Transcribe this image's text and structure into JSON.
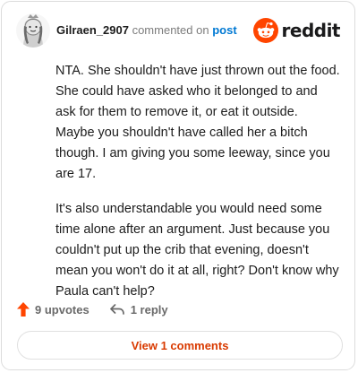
{
  "header": {
    "username": "Gilraen_2907",
    "action_text": "commented on",
    "target_link": "post",
    "brand_name": "reddit",
    "brand_color": "#ff4500"
  },
  "comment": {
    "paragraphs": [
      "NTA. She shouldn't have just thrown out the food. She could have asked who it belonged to and ask for them to remove it, or eat it outside. Maybe you shouldn't have called her a bitch though. I am giving you some leeway, since you are 17.",
      "It's also understandable you would need some time alone after an argument. Just because you couldn't put up the crib that evening, doesn't mean you won't do it at all, right? Don't know why Paula can't help?"
    ]
  },
  "actions": {
    "upvotes_label": "9 upvotes",
    "upvote_icon": "upvote-arrow-icon",
    "upvote_color": "#ff4500",
    "reply_label": "1 reply",
    "reply_icon": "reply-arrow-icon"
  },
  "footer": {
    "view_comments_label": "View 1 comments",
    "accent_color": "#d93a00"
  }
}
